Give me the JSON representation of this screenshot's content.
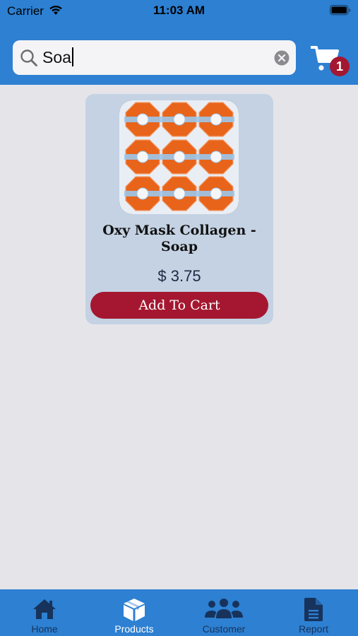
{
  "status_bar": {
    "carrier": "Carrier",
    "time": "11:03 AM"
  },
  "search": {
    "value": "Soa"
  },
  "cart": {
    "badge_count": "1"
  },
  "product": {
    "name": "Oxy Mask Collagen - Soap",
    "price": "$ 3.75",
    "add_to_cart_label": "Add To Cart"
  },
  "tabs": [
    {
      "label": "Home",
      "icon": "home-icon"
    },
    {
      "label": "Products",
      "icon": "box-icon",
      "active": true
    },
    {
      "label": "Customer",
      "icon": "people-icon"
    },
    {
      "label": "Report",
      "icon": "document-icon"
    }
  ],
  "colors": {
    "header_bg": "#2d80d2",
    "accent_red": "#a51730",
    "card_bg": "#c4d2e3",
    "page_bg": "#e5e5e9",
    "tab_inactive": "#17335c",
    "tab_active": "#ffffff"
  }
}
